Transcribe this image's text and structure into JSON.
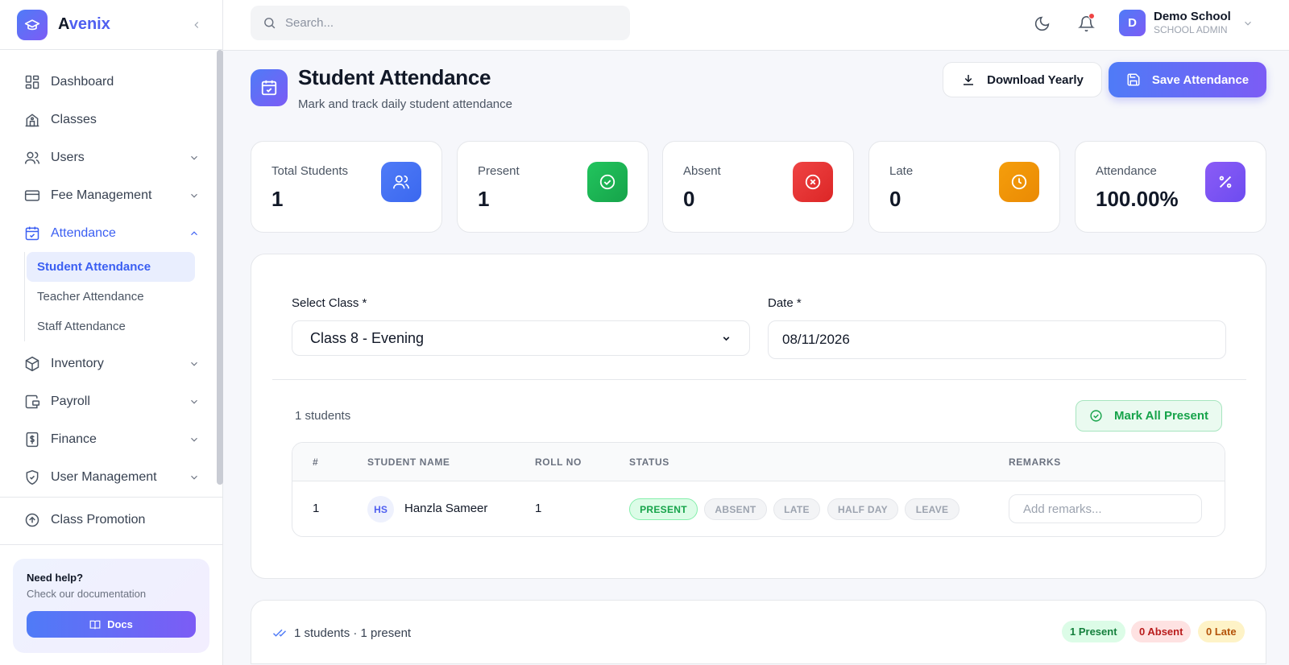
{
  "brand": {
    "name_first": "A",
    "name_rest": "venix"
  },
  "sidebar": {
    "items": [
      {
        "label": "Dashboard"
      },
      {
        "label": "Classes"
      },
      {
        "label": "Users"
      },
      {
        "label": "Fee Management"
      },
      {
        "label": "Attendance"
      },
      {
        "label": "Inventory"
      },
      {
        "label": "Payroll"
      },
      {
        "label": "Finance"
      },
      {
        "label": "User Management"
      }
    ],
    "sub_items": [
      {
        "label": "Student Attendance"
      },
      {
        "label": "Teacher Attendance"
      },
      {
        "label": "Staff Attendance"
      }
    ],
    "promotion": "Class Promotion",
    "help": {
      "title": "Need help?",
      "subtitle": "Check our documentation",
      "button": "Docs"
    }
  },
  "header": {
    "search_placeholder": "Search...",
    "user": {
      "initial": "D",
      "name": "Demo School",
      "role": "SCHOOL ADMIN"
    }
  },
  "page": {
    "title": "Student Attendance",
    "subtitle": "Mark and track daily student attendance",
    "download_label": "Download Yearly",
    "save_label": "Save Attendance"
  },
  "stats": [
    {
      "label": "Total Students",
      "value": "1",
      "color": "#4f7bf7"
    },
    {
      "label": "Present",
      "value": "1",
      "color": "#16a34a"
    },
    {
      "label": "Absent",
      "value": "0",
      "color": "#e53935"
    },
    {
      "label": "Late",
      "value": "0",
      "color": "#f59e0b"
    },
    {
      "label": "Attendance",
      "value": "100.00%",
      "color": "#7c5cf5"
    }
  ],
  "form": {
    "class_label": "Select Class *",
    "class_value": "Class 8 - Evening",
    "date_label": "Date *",
    "date_value": "08/11/2026"
  },
  "list": {
    "count": "1 students",
    "mark_all": "Mark All Present",
    "columns": [
      "#",
      "STUDENT NAME",
      "ROLL NO",
      "STATUS",
      "REMARKS"
    ],
    "rows": [
      {
        "index": "1",
        "initials": "HS",
        "name": "Hanzla Sameer",
        "roll": "1",
        "statuses": [
          "PRESENT",
          "ABSENT",
          "LATE",
          "HALF DAY",
          "LEAVE"
        ],
        "selected_status": "PRESENT",
        "remarks_placeholder": "Add remarks..."
      }
    ]
  },
  "footer": {
    "summary": "1 students · 1 present",
    "pills": [
      {
        "label": "1 Present"
      },
      {
        "label": "0 Absent"
      },
      {
        "label": "0 Late"
      }
    ]
  }
}
